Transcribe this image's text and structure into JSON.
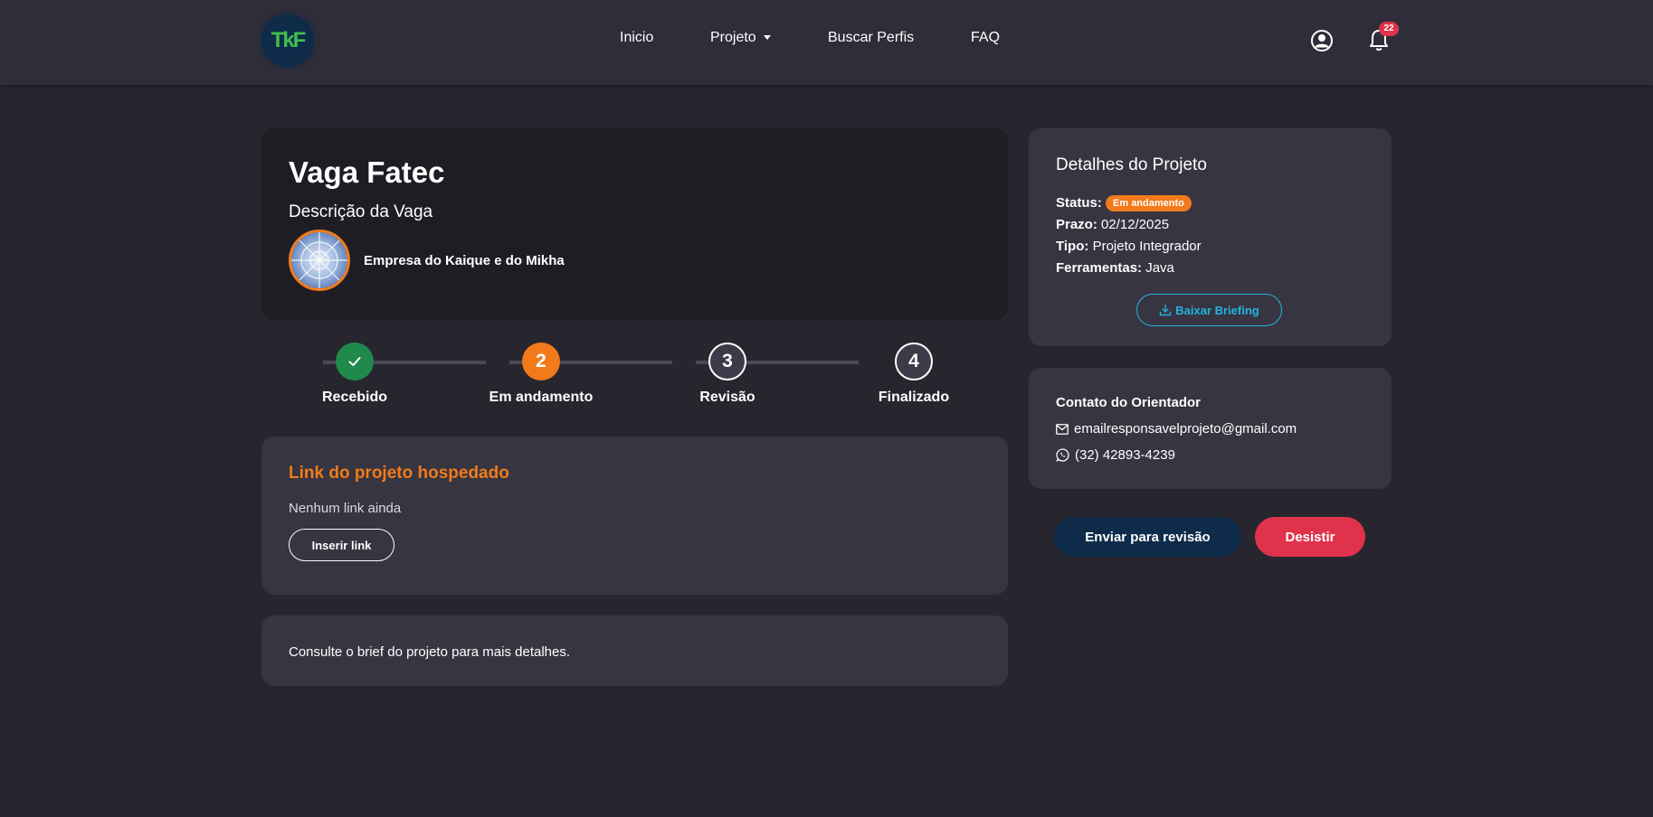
{
  "navbar": {
    "logo_text": "TkF",
    "links": [
      {
        "label": "Inicio"
      },
      {
        "label": "Projeto"
      },
      {
        "label": "Buscar Perfis"
      },
      {
        "label": "FAQ"
      }
    ],
    "notification_count": "22",
    "icons": [
      "user-circle-icon",
      "bell-icon",
      "chevron-down-icon"
    ]
  },
  "project": {
    "title": "Vaga Fatec",
    "subtitle": "Descrição da Vaga",
    "company_name": "Empresa do Kaique e do Mikha"
  },
  "stepper": {
    "steps": [
      {
        "label": "Recebido",
        "marker": "✓",
        "state": "done",
        "color": "#1f8a4c"
      },
      {
        "label": "Em andamento",
        "marker": "2",
        "state": "active",
        "color": "#f27a1a"
      },
      {
        "label": "Revisão",
        "marker": "3",
        "state": "pending",
        "color": "#3c3b4a"
      },
      {
        "label": "Finalizado",
        "marker": "4",
        "state": "pending",
        "color": "#3c3b4a"
      }
    ]
  },
  "hosted_link": {
    "title": "Link do projeto hospedado",
    "empty_text": "Nenhum link ainda",
    "insert_button": "Inserir link"
  },
  "brief_note": "Consulte o brief do projeto para mais detalhes.",
  "details": {
    "title": "Detalhes do Projeto",
    "status_label": "Status:",
    "status_value": "Em andamento",
    "deadline_label": "Prazo:",
    "deadline_value": "02/12/2025",
    "type_label": "Tipo:",
    "type_value": "Projeto Integrador",
    "tools_label": "Ferramentas:",
    "tools_value": "Java",
    "briefing_button": "Baixar Briefing"
  },
  "contact": {
    "title": "Contato do Orientador",
    "email": "emailresponsavelprojeto@gmail.com",
    "phone": "(32) 42893-4239"
  },
  "actions": {
    "submit_review": "Enviar para revisão",
    "give_up": "Desistir"
  },
  "colors": {
    "accent_orange": "#f27a1a",
    "success_green": "#1f8a4c",
    "danger_red": "#e0334b",
    "navy": "#0e2b4a",
    "info_blue": "#23b4e0"
  }
}
